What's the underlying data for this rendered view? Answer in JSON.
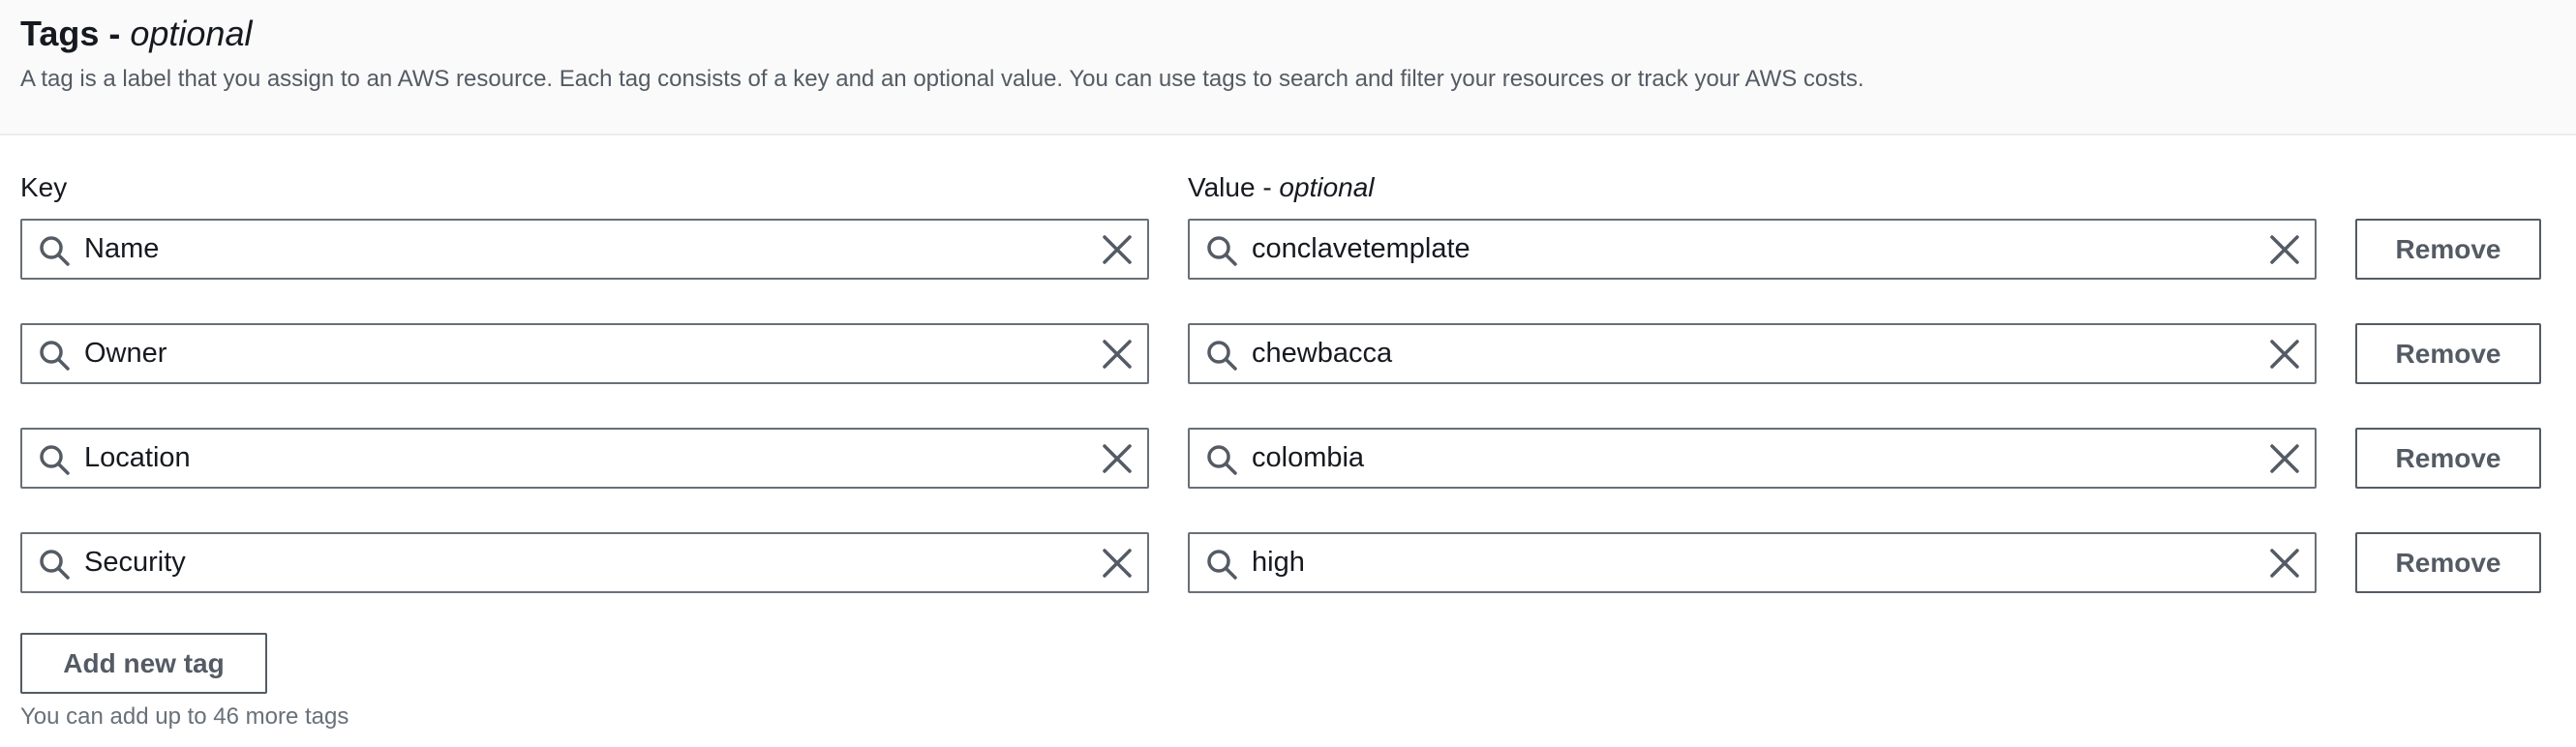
{
  "header": {
    "title": "Tags -",
    "title_optional": "optional",
    "description": "A tag is a label that you assign to an AWS resource. Each tag consists of a key and an optional value. You can use tags to search and filter your resources or track your AWS costs."
  },
  "columns": {
    "key_label": "Key",
    "value_label": "Value -",
    "value_optional": "optional"
  },
  "tags": [
    {
      "key": "Name",
      "value": "conclavetemplate",
      "remove_label": "Remove"
    },
    {
      "key": "Owner",
      "value": "chewbacca",
      "remove_label": "Remove"
    },
    {
      "key": "Location",
      "value": "colombia",
      "remove_label": "Remove"
    },
    {
      "key": "Security",
      "value": "high",
      "remove_label": "Remove"
    }
  ],
  "add_button_label": "Add new tag",
  "limit_note": "You can add up to 46 more tags",
  "icons": {
    "search": "search-icon",
    "clear": "close-icon"
  },
  "colors": {
    "text": "#16191f",
    "secondary_text": "#545b64",
    "border": "#687078",
    "header_bg": "#fafafa"
  }
}
